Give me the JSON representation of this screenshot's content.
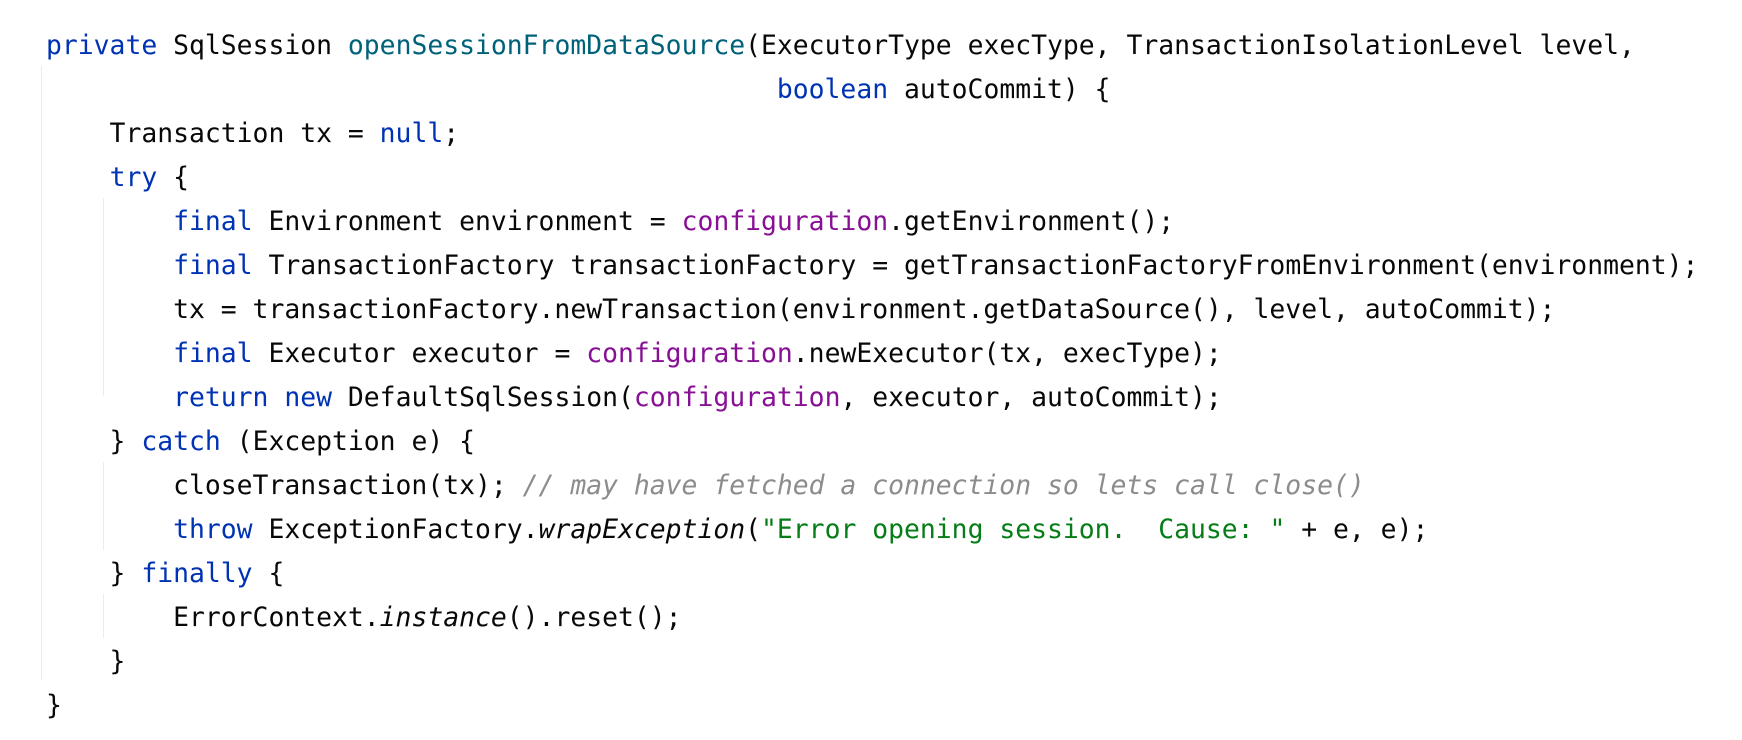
{
  "editor": {
    "lines": [
      [
        {
          "t": "private",
          "c": "kw"
        },
        {
          "t": " SqlSession "
        },
        {
          "t": "openSessionFromDataSource",
          "c": "fn"
        },
        {
          "t": "(ExecutorType execType, TransactionIsolationLevel level,"
        }
      ],
      [
        {
          "t": "                                              "
        },
        {
          "t": "boolean",
          "c": "kw"
        },
        {
          "t": " autoCommit) {"
        }
      ],
      [
        {
          "t": "    Transaction tx = "
        },
        {
          "t": "null",
          "c": "kw"
        },
        {
          "t": ";"
        }
      ],
      [
        {
          "t": "    "
        },
        {
          "t": "try",
          "c": "kw"
        },
        {
          "t": " {"
        }
      ],
      [
        {
          "t": "        "
        },
        {
          "t": "final",
          "c": "kw"
        },
        {
          "t": " Environment environment = "
        },
        {
          "t": "configuration",
          "c": "fld"
        },
        {
          "t": ".getEnvironment();"
        }
      ],
      [
        {
          "t": "        "
        },
        {
          "t": "final",
          "c": "kw"
        },
        {
          "t": " TransactionFactory transactionFactory = getTransactionFactoryFromEnvironment(environment);"
        }
      ],
      [
        {
          "t": "        tx = transactionFactory.newTransaction(environment.getDataSource(), level, autoCommit);"
        }
      ],
      [
        {
          "t": "        "
        },
        {
          "t": "final",
          "c": "kw"
        },
        {
          "t": " Executor executor = "
        },
        {
          "t": "configuration",
          "c": "fld"
        },
        {
          "t": ".newExecutor(tx, execType);"
        }
      ],
      [
        {
          "t": "        "
        },
        {
          "t": "return",
          "c": "kw"
        },
        {
          "t": " "
        },
        {
          "t": "new",
          "c": "kw"
        },
        {
          "t": " DefaultSqlSession("
        },
        {
          "t": "configuration",
          "c": "fld"
        },
        {
          "t": ", executor, autoCommit);"
        }
      ],
      [
        {
          "t": "    } "
        },
        {
          "t": "catch",
          "c": "kw"
        },
        {
          "t": " (Exception e) {"
        }
      ],
      [
        {
          "t": "        closeTransaction(tx); "
        },
        {
          "t": "// may have fetched a connection so lets call close()",
          "c": "cmt"
        }
      ],
      [
        {
          "t": "        "
        },
        {
          "t": "throw",
          "c": "kw"
        },
        {
          "t": " ExceptionFactory."
        },
        {
          "t": "wrapException",
          "c": "it"
        },
        {
          "t": "("
        },
        {
          "t": "\"Error opening session.  Cause: \"",
          "c": "str"
        },
        {
          "t": " + e, e);"
        }
      ],
      [
        {
          "t": "    } "
        },
        {
          "t": "finally",
          "c": "kw"
        },
        {
          "t": " {"
        }
      ],
      [
        {
          "t": "        ErrorContext."
        },
        {
          "t": "instance",
          "c": "it"
        },
        {
          "t": "().reset();"
        }
      ],
      [
        {
          "t": "    }"
        }
      ],
      [
        {
          "t": "}"
        }
      ]
    ]
  },
  "colors": {
    "keyword": "#0033b3",
    "method_declaration": "#00627a",
    "field": "#871094",
    "string": "#067d17",
    "comment": "#8c8c8c",
    "text": "#080808",
    "background": "#ffffff"
  }
}
